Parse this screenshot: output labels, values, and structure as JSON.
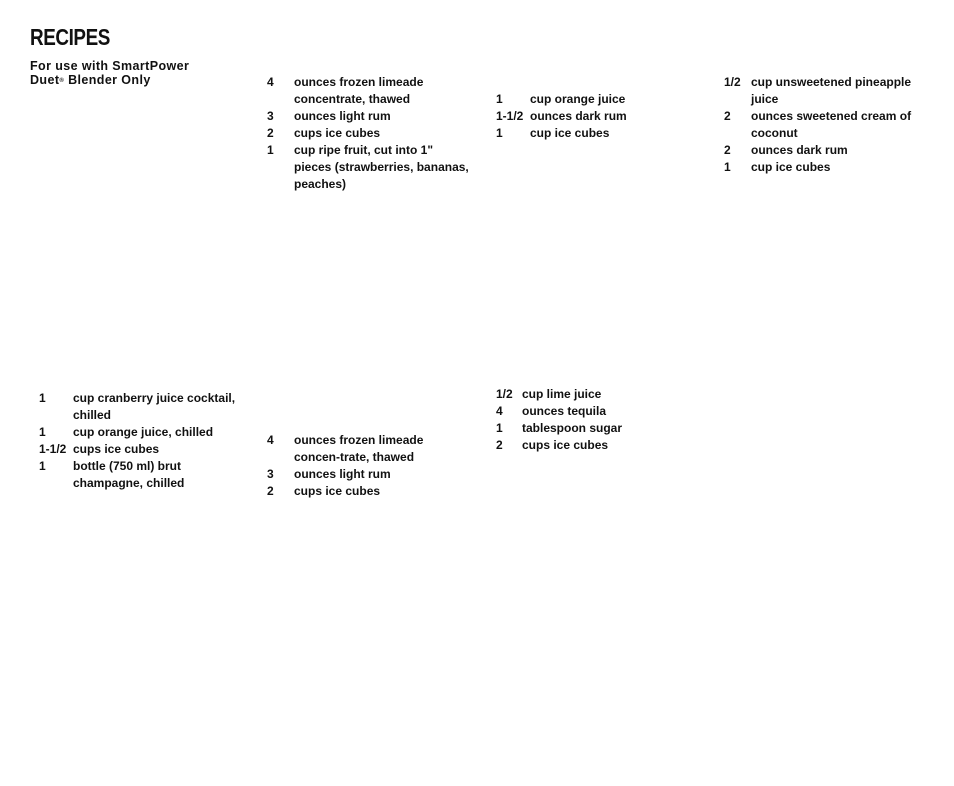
{
  "header": {
    "title": "RECIPES",
    "subtitle_line1": "For use with SmartPower",
    "subtitle_line2_a": "Duet",
    "subtitle_reg": "®",
    "subtitle_line2_b": " Blender Only"
  },
  "recipes": [
    {
      "ingredients": [
        {
          "qty": "4",
          "desc": "ounces frozen limeade concentrate, thawed"
        },
        {
          "qty": "3",
          "desc": "ounces light rum"
        },
        {
          "qty": "2",
          "desc": "cups ice cubes"
        },
        {
          "qty": "1",
          "desc": "cup ripe fruit, cut into 1\" pieces (strawberries, bananas, peaches)"
        }
      ]
    },
    {
      "ingredients": [
        {
          "qty": "1",
          "desc": "cup orange juice"
        },
        {
          "qty": "1-1/2",
          "desc": "ounces dark rum"
        },
        {
          "qty": "1",
          "desc": "cup ice cubes"
        }
      ]
    },
    {
      "ingredients": [
        {
          "qty": "1/2",
          "desc": "cup unsweetened pineapple juice"
        },
        {
          "qty": "2",
          "desc": "ounces sweetened cream of coconut"
        },
        {
          "qty": "2",
          "desc": "ounces dark rum"
        },
        {
          "qty": "1",
          "desc": "cup ice cubes"
        }
      ]
    },
    {
      "ingredients": [
        {
          "qty": "1",
          "desc": "cup cranberry juice cocktail, chilled"
        },
        {
          "qty": "1",
          "desc": "cup orange juice, chilled"
        },
        {
          "qty": "1-1/2",
          "desc": "cups ice cubes"
        },
        {
          "qty": "1",
          "desc": "bottle (750 ml) brut champagne, chilled"
        }
      ]
    },
    {
      "ingredients": [
        {
          "qty": "4",
          "desc": "ounces frozen limeade concen-trate, thawed"
        },
        {
          "qty": "3",
          "desc": "ounces light rum"
        },
        {
          "qty": "2",
          "desc": "cups ice cubes"
        }
      ]
    },
    {
      "ingredients": [
        {
          "qty": "1/2",
          "desc": "cup lime juice"
        },
        {
          "qty": "4",
          "desc": "ounces tequila"
        },
        {
          "qty": "1",
          "desc": "tablespoon sugar"
        },
        {
          "qty": "2",
          "desc": "cups ice cubes"
        }
      ]
    }
  ]
}
